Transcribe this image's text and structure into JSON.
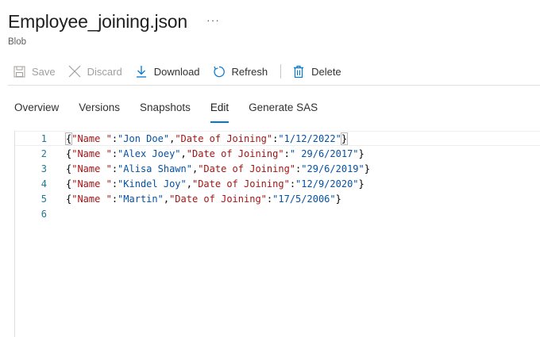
{
  "header": {
    "title": "Employee_joining.json",
    "subtitle": "Blob",
    "more": "···"
  },
  "toolbar": {
    "save": "Save",
    "discard": "Discard",
    "download": "Download",
    "refresh": "Refresh",
    "delete": "Delete"
  },
  "tabs": {
    "overview": "Overview",
    "versions": "Versions",
    "snapshots": "Snapshots",
    "edit": "Edit",
    "generate_sas": "Generate SAS"
  },
  "editor": {
    "line_numbers": [
      "1",
      "2",
      "3",
      "4",
      "5",
      "6"
    ],
    "key_name": "\"Name \"",
    "key_date": "\"Date of Joining\"",
    "rows": [
      {
        "name": "\"Jon Doe\"",
        "date": "\"1/12/2022\""
      },
      {
        "name": "\"Alex Joey\"",
        "date": "\" 29/6/2017\""
      },
      {
        "name": "\"Alisa Shawn\"",
        "date": "\"29/6/2019\""
      },
      {
        "name": "\"Kindel Joy\"",
        "date": "\"12/9/2020\""
      },
      {
        "name": "\"Martin\"",
        "date": "\"17/5/2006\""
      }
    ]
  }
}
